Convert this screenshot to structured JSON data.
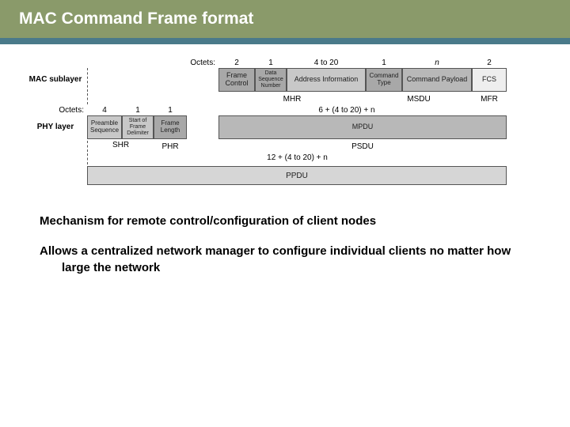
{
  "header": {
    "title": "MAC Command Frame format"
  },
  "diagram": {
    "macSubLabel": "MAC sublayer",
    "phyLabel": "PHY layer",
    "octetsLabel1": "Octets:",
    "octetsLabel2": "Octets:",
    "macOctets": {
      "c1": "2",
      "c2": "1",
      "c3": "4 to 20",
      "c4": "1",
      "c5": "n",
      "c6": "2"
    },
    "macCells": {
      "c1": "Frame Control",
      "c2": "Data Sequence Number",
      "c3": "Address Information",
      "c4": "Command Type",
      "c5": "Command Payload",
      "c6": "FCS"
    },
    "macGroups": {
      "g1": "MHR",
      "g2": "MSDU",
      "g3": "MFR"
    },
    "phyOctets": {
      "c1": "4",
      "c2": "1",
      "c3": "1",
      "c4": "6 + (4 to 20) + n"
    },
    "phyCells": {
      "c1": "Preamble Sequence",
      "c2": "Start of Frame Delimiter",
      "c3": "Frame Length",
      "c4": "MPDU"
    },
    "phyGroups": {
      "g1": "SHR",
      "g2": "PHR",
      "g3": "PSDU"
    },
    "bottomOctets": "12 + (4 to 20) + n",
    "bottomCell": "PPDU"
  },
  "body": {
    "p1": "Mechanism for remote control/configuration of client nodes",
    "p2": "Allows a centralized network manager to configure individual clients no matter how large the network"
  }
}
